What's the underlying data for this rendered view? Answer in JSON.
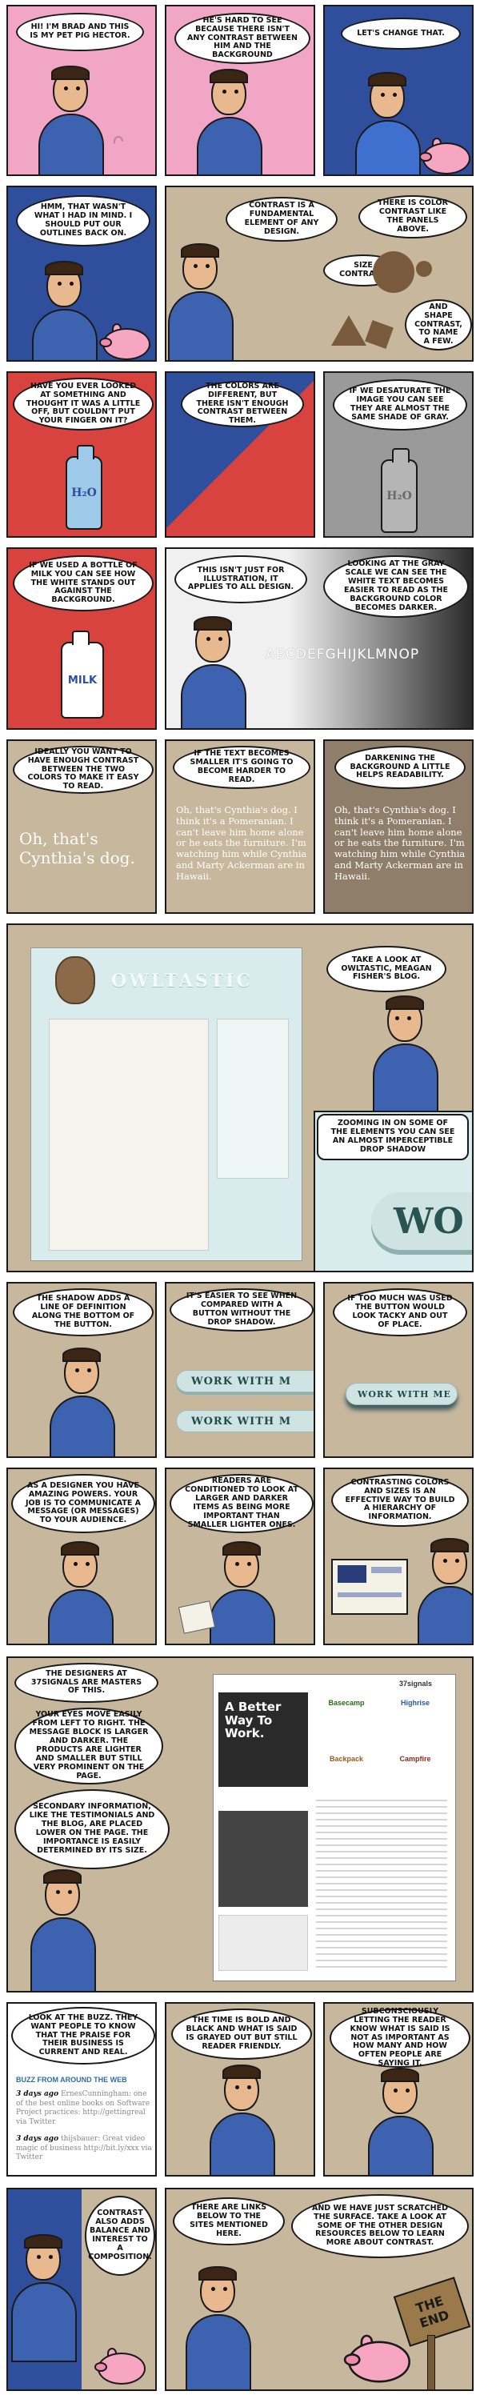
{
  "panels": [
    {
      "text": "Hi! I'm Brad and this is my pet pig Hector."
    },
    {
      "text": "He's hard to see because there isn't any contrast between him and the background"
    },
    {
      "text": "Let's change that."
    },
    {
      "text": "Hmm, that wasn't what I had in mind. I should put our outlines back on."
    },
    {
      "text": "Contrast is a fundamental element of any design.",
      "text2": "There is color contrast like the panels above.",
      "text3": "Size contrast.",
      "text4": "And shape contrast, to name a few."
    },
    {
      "text": "Have you ever looked at something and thought it was a little off, but couldn't put your finger on it?"
    },
    {
      "text": "The colors are different, but there isn't enough contrast between them."
    },
    {
      "text": "If we desaturate the image you can see they are almost the same shade of gray."
    },
    {
      "text": "If we used a bottle of milk you can see how the white stands out against the background."
    },
    {
      "text": "This isn't just for illustration, it applies to all design."
    },
    {
      "text": "Looking at the gray scale we can see the white text becomes easier to read as the background color becomes darker."
    },
    {
      "text": "Ideally you want to have enough contrast between the two colors to make it easy to read."
    },
    {
      "text": "If the text becomes smaller it's going to become harder to read."
    },
    {
      "text": "Darkening the background a little helps readability."
    },
    {
      "text": "Take a look at Owltastic, Meagan Fisher's blog."
    },
    {
      "text": "Zooming in on some of the elements you can see an almost imperceptible drop shadow"
    },
    {
      "text": "The shadow adds a line of definition along the bottom of the button."
    },
    {
      "text": "It's easier to see when compared with a button without the drop shadow."
    },
    {
      "text": "If too much was used the button would look tacky and out of place."
    },
    {
      "text": "As a designer you have amazing powers. Your job is to communicate a message (or messages) to your audience."
    },
    {
      "text": "Readers are conditioned to look at larger and darker items as being more important than smaller lighter ones."
    },
    {
      "text": "Contrasting colors and sizes is an effective way to build a hierarchy of information."
    },
    {
      "text": "The designers at 37signals are masters of this.",
      "text2": "Your eyes move easily from left to right. The message block is larger and darker. The products are lighter and smaller but still very prominent on the page.",
      "text3": "Secondary information, like the testimonials and the blog, are placed lower on the page. The importance is easily determined by its size."
    },
    {
      "text": "Look at the buzz. They want people to know that the praise for their business is current and real."
    },
    {
      "text": "The time is bold and black and what is said is grayed out but still reader friendly."
    },
    {
      "text": "Subconsciously letting the reader know what is said is not as important as how many and how often people are saying it."
    },
    {
      "text": "Contrast also adds balance and interest to a composition."
    },
    {
      "text": "There are links below to the sites mentioned here."
    },
    {
      "text": "And we have just scratched the surface. Take a look at some of the other design resources below to learn more about contrast."
    }
  ],
  "art": {
    "h2o": "H₂O",
    "milk": "MILK",
    "alphabet": "ABCDEFGHIJKLMNOP",
    "cynthia": "Oh, that's Cynthia's dog.",
    "cynthia_long": "Oh, that's Cynthia's dog. I think it's a Pomeranian. I can't leave him home alone or he eats the furniture. I'm watching him while Cynthia and Marty Ackerman are in Hawaii.",
    "owltastic_logo": "OWLTASTIC",
    "work_partial": "WO",
    "work_with_m": "WORK WITH M",
    "work_with_me": "WORK WITH ME",
    "signals_headline": "A Better Way To Work.",
    "signals_products": [
      "Basecamp",
      "Highrise",
      "Backpack",
      "Campfire"
    ],
    "signals_logo": "37signals",
    "buzz_title": "BUZZ FROM AROUND THE WEB",
    "buzz_time_1": "3 days ago",
    "buzz_text_1": "ErnesCunningham: one of the best online books on Software Project practices: http://gettingreal via Twitter",
    "buzz_time_2": "3 days ago",
    "buzz_text_2": "thijsbauer: Great video magic of business http://bit.ly/xxx via Twitter",
    "the_end": "THE END"
  },
  "colors": {
    "pink": "#f2a6c6",
    "blue": "#2f4f9c",
    "red": "#d9433f",
    "tan": "#c7b79c",
    "brown": "#8f7f6a",
    "grey": "#9a9a9a"
  }
}
